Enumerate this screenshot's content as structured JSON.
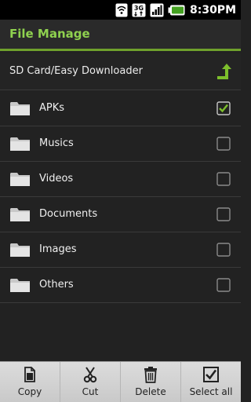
{
  "status_bar": {
    "time": "8:30PM",
    "network": "3G"
  },
  "header": {
    "title": "File Manage"
  },
  "path_bar": {
    "path": "SD Card/Easy Downloader",
    "up_icon": "folder-up-icon"
  },
  "folders": [
    {
      "label": "APKs",
      "checked": true
    },
    {
      "label": "Musics",
      "checked": false
    },
    {
      "label": "Videos",
      "checked": false
    },
    {
      "label": "Documents",
      "checked": false
    },
    {
      "label": "Images",
      "checked": false
    },
    {
      "label": "Others",
      "checked": false
    }
  ],
  "actions": [
    {
      "label": "Copy",
      "icon": "copy-icon"
    },
    {
      "label": "Cut",
      "icon": "scissors-icon"
    },
    {
      "label": "Delete",
      "icon": "trash-icon"
    },
    {
      "label": "Select all",
      "icon": "select-all-icon"
    }
  ],
  "colors": {
    "accent": "#6fa12c",
    "title": "#8fd14f",
    "background": "#222222"
  }
}
